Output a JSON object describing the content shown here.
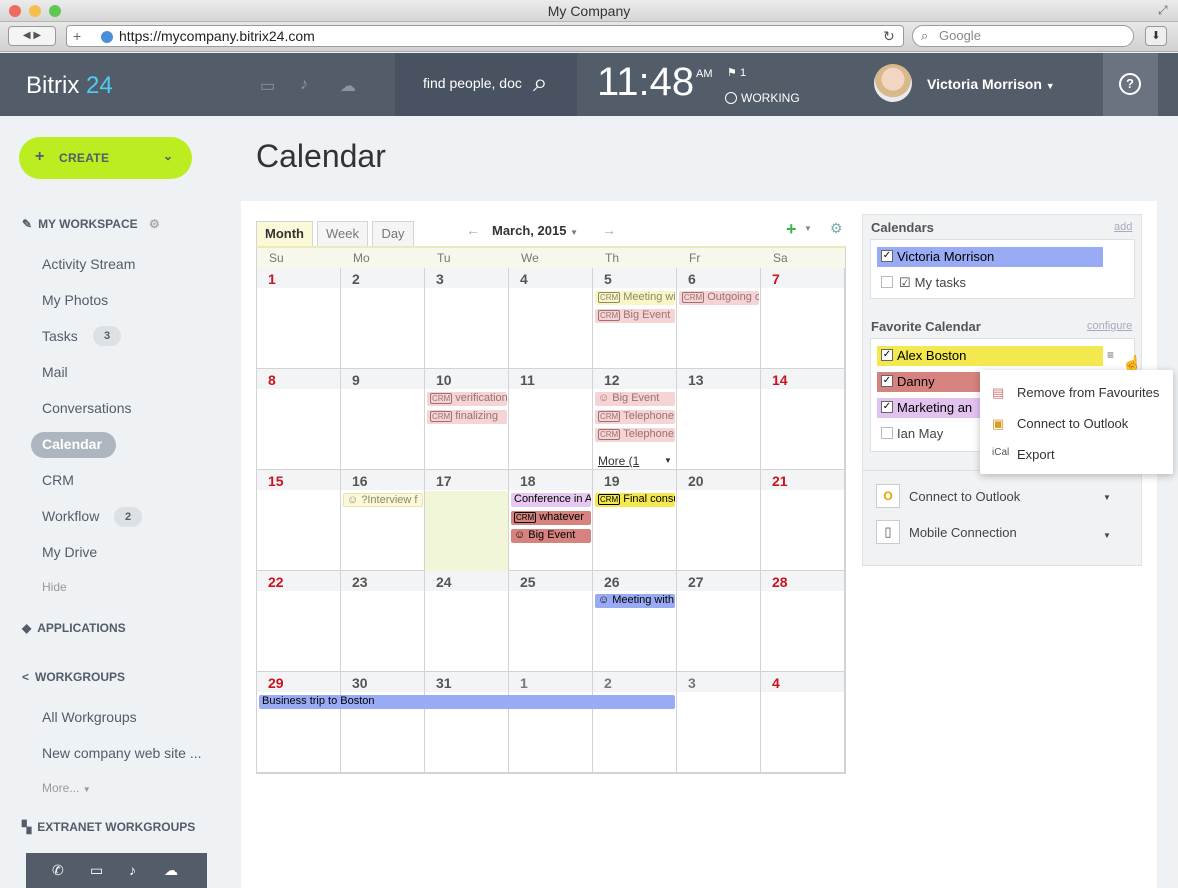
{
  "window": {
    "title": "My Company"
  },
  "browser": {
    "url": "https://mycompany.bitrix24.com",
    "search_placeholder": "Google"
  },
  "header": {
    "logo_a": "Bitrix",
    "logo_b": "24",
    "search_placeholder": "find people, doc",
    "time": "11:48",
    "ampm": "AM",
    "flag_count": "1",
    "work_status": "WORKING",
    "user_name": "Victoria Morrison",
    "help": "?"
  },
  "sidebar": {
    "create_label": "CREATE",
    "my_workspace": "MY WORKSPACE",
    "items": [
      {
        "label": "Activity Stream"
      },
      {
        "label": "My Photos"
      },
      {
        "label": "Tasks",
        "badge": "3"
      },
      {
        "label": "Mail"
      },
      {
        "label": "Conversations"
      },
      {
        "label": "Calendar"
      },
      {
        "label": "CRM"
      },
      {
        "label": "Workflow",
        "badge": "2"
      },
      {
        "label": "My Drive"
      }
    ],
    "hide": "Hide",
    "applications": "APPLICATIONS",
    "workgroups": "WORKGROUPS",
    "wg_items": [
      "All Workgroups",
      "New company web site ..."
    ],
    "more": "More...",
    "extranet": "EXTRANET WORKGROUPS"
  },
  "page": {
    "title": "Calendar"
  },
  "calendar": {
    "tabs": [
      "Month",
      "Week",
      "Day"
    ],
    "month_label": "March, 2015",
    "day_headers": [
      "Su",
      "Mo",
      "Tu",
      "We",
      "Th",
      "Fr",
      "Sa"
    ],
    "weeks": [
      [
        "1",
        "2",
        "3",
        "4",
        "5",
        "6",
        "7"
      ],
      [
        "8",
        "9",
        "10",
        "11",
        "12",
        "13",
        "14"
      ],
      [
        "15",
        "16",
        "17",
        "18",
        "19",
        "20",
        "21"
      ],
      [
        "22",
        "23",
        "24",
        "25",
        "26",
        "27",
        "28"
      ],
      [
        "29",
        "30",
        "31",
        "1",
        "2",
        "3",
        "4"
      ]
    ],
    "events": {
      "e1": "Meeting with",
      "e2": "Big Event",
      "e3": "Outgoing ca",
      "e4": "verification",
      "e5": "finalizing",
      "e6": "Big Event",
      "e7": "Telephone c",
      "e8": "Telephone c",
      "more": "More (1",
      "e9": "?Interview f",
      "e10": "Conference in A",
      "e11": "whatever",
      "e12": "Big Event",
      "e13": "Final consul",
      "e14": "Meeting with",
      "e15": "Business trip to Boston"
    },
    "crm_tag": "CRM"
  },
  "panel": {
    "calendars_title": "Calendars",
    "add": "add",
    "cal1": "Victoria Morrison",
    "cal2": "My tasks",
    "fav_title": "Favorite Calendar",
    "configure": "configure",
    "fav": [
      "Alex Boston",
      "Danny",
      "Marketing an",
      "Ian May"
    ],
    "outlook": "Connect to Outlook",
    "mobile": "Mobile Connection"
  },
  "menu": {
    "items": [
      "Remove from Favourites",
      "Connect to Outlook",
      "Export"
    ]
  },
  "colors": {
    "accent": "#bbed21",
    "header": "#535c69",
    "today": "#f0f5d6",
    "sunday": "#c8141e",
    "blue_event": "#9aabf5",
    "yellow_cal": "#f3e94e",
    "red_cal": "#d6837f",
    "purple_cal": "#e2c2ef"
  }
}
